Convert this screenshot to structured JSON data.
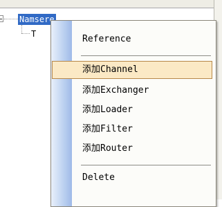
{
  "tree": {
    "root_label": "Namsere",
    "child_label": "T"
  },
  "context_menu": {
    "items": [
      {
        "label": "Reference"
      },
      {
        "label": "添加Channel",
        "highlighted": true
      },
      {
        "label": "添加Exchanger"
      },
      {
        "label": "添加Loader"
      },
      {
        "label": "添加Filter"
      },
      {
        "label": "添加Router"
      },
      {
        "label": "Delete"
      }
    ]
  },
  "colors": {
    "selection": "#316ac5",
    "menu_highlight": "#fbe9c5",
    "menu_highlight_border": "#b7884a",
    "gutter": "#c3d6f2"
  }
}
